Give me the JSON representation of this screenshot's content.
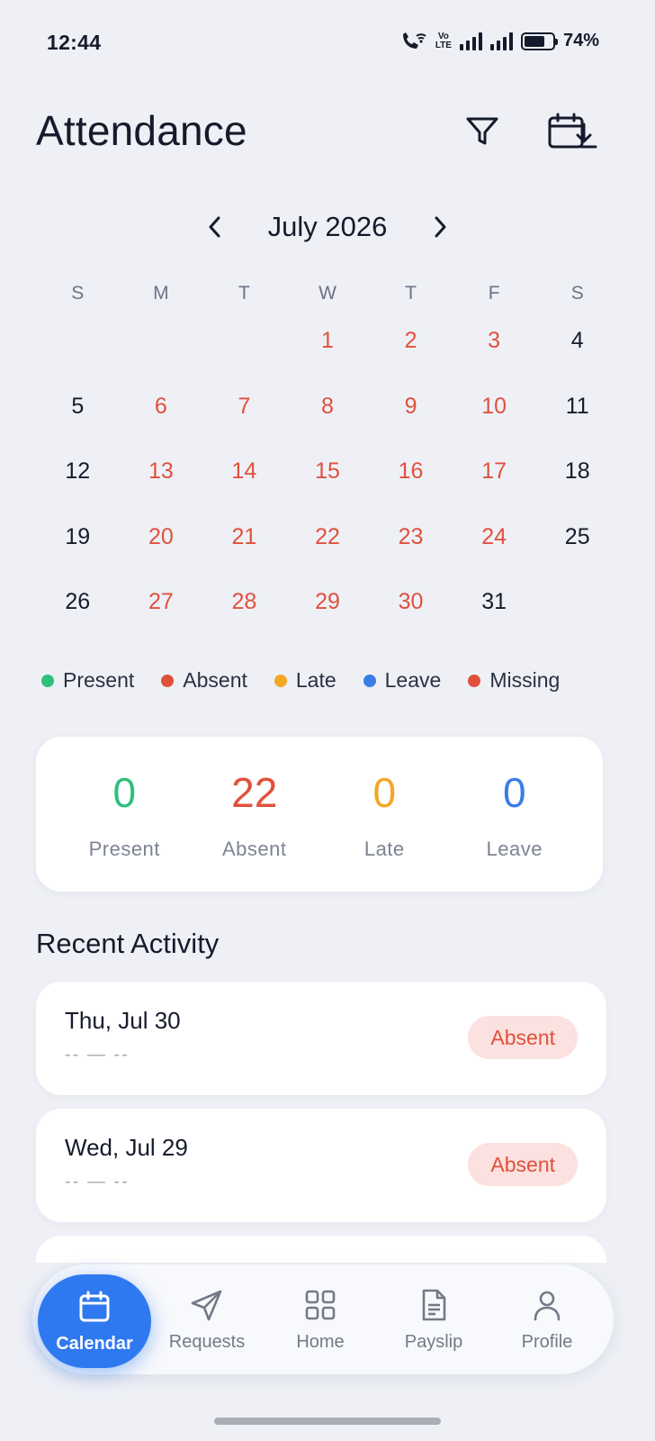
{
  "status_bar": {
    "time": "12:44",
    "lte_top": "Vo",
    "lte_bottom": "LTE",
    "battery": "74%"
  },
  "header": {
    "title": "Attendance",
    "filter_icon": "filter-icon",
    "export_icon": "calendar-download-icon"
  },
  "calendar": {
    "month_label": "July 2026",
    "weekdays": [
      "S",
      "M",
      "T",
      "W",
      "T",
      "F",
      "S"
    ],
    "weeks": [
      [
        {
          "d": "",
          "s": "none"
        },
        {
          "d": "",
          "s": "none"
        },
        {
          "d": "",
          "s": "none"
        },
        {
          "d": "1",
          "s": "absent"
        },
        {
          "d": "2",
          "s": "absent"
        },
        {
          "d": "3",
          "s": "absent"
        },
        {
          "d": "4",
          "s": "normal"
        }
      ],
      [
        {
          "d": "5",
          "s": "normal"
        },
        {
          "d": "6",
          "s": "absent"
        },
        {
          "d": "7",
          "s": "absent"
        },
        {
          "d": "8",
          "s": "absent"
        },
        {
          "d": "9",
          "s": "absent"
        },
        {
          "d": "10",
          "s": "absent"
        },
        {
          "d": "11",
          "s": "normal"
        }
      ],
      [
        {
          "d": "12",
          "s": "normal"
        },
        {
          "d": "13",
          "s": "absent"
        },
        {
          "d": "14",
          "s": "absent"
        },
        {
          "d": "15",
          "s": "absent"
        },
        {
          "d": "16",
          "s": "absent"
        },
        {
          "d": "17",
          "s": "absent"
        },
        {
          "d": "18",
          "s": "normal"
        }
      ],
      [
        {
          "d": "19",
          "s": "normal"
        },
        {
          "d": "20",
          "s": "absent"
        },
        {
          "d": "21",
          "s": "absent"
        },
        {
          "d": "22",
          "s": "absent"
        },
        {
          "d": "23",
          "s": "absent"
        },
        {
          "d": "24",
          "s": "absent"
        },
        {
          "d": "25",
          "s": "normal"
        }
      ],
      [
        {
          "d": "26",
          "s": "normal"
        },
        {
          "d": "27",
          "s": "absent"
        },
        {
          "d": "28",
          "s": "absent"
        },
        {
          "d": "29",
          "s": "absent"
        },
        {
          "d": "30",
          "s": "absent"
        },
        {
          "d": "31",
          "s": "normal"
        },
        {
          "d": "",
          "s": "none"
        }
      ]
    ]
  },
  "legend": [
    {
      "label": "Present",
      "color": "#2fc07e"
    },
    {
      "label": "Absent",
      "color": "#e0513c"
    },
    {
      "label": "Late",
      "color": "#f5a623"
    },
    {
      "label": "Leave",
      "color": "#3b7de6"
    },
    {
      "label": "Missing",
      "color": "#e0513c"
    }
  ],
  "summary": [
    {
      "value": "0",
      "label": "Present",
      "color": "#2fc07e"
    },
    {
      "value": "22",
      "label": "Absent",
      "color": "#e0513c"
    },
    {
      "value": "0",
      "label": "Late",
      "color": "#f5a623"
    },
    {
      "value": "0",
      "label": "Leave",
      "color": "#3b7de6"
    }
  ],
  "recent_activity": {
    "title": "Recent Activity",
    "items": [
      {
        "date": "Thu, Jul 30",
        "time": "-- — --",
        "status": "Absent"
      },
      {
        "date": "Wed, Jul 29",
        "time": "-- — --",
        "status": "Absent"
      }
    ]
  },
  "bottom_nav": [
    {
      "label": "Calendar",
      "icon": "calendar-icon",
      "active": true
    },
    {
      "label": "Requests",
      "icon": "send-icon",
      "active": false
    },
    {
      "label": "Home",
      "icon": "grid-icon",
      "active": false
    },
    {
      "label": "Payslip",
      "icon": "document-icon",
      "active": false
    },
    {
      "label": "Profile",
      "icon": "user-icon",
      "active": false
    }
  ]
}
